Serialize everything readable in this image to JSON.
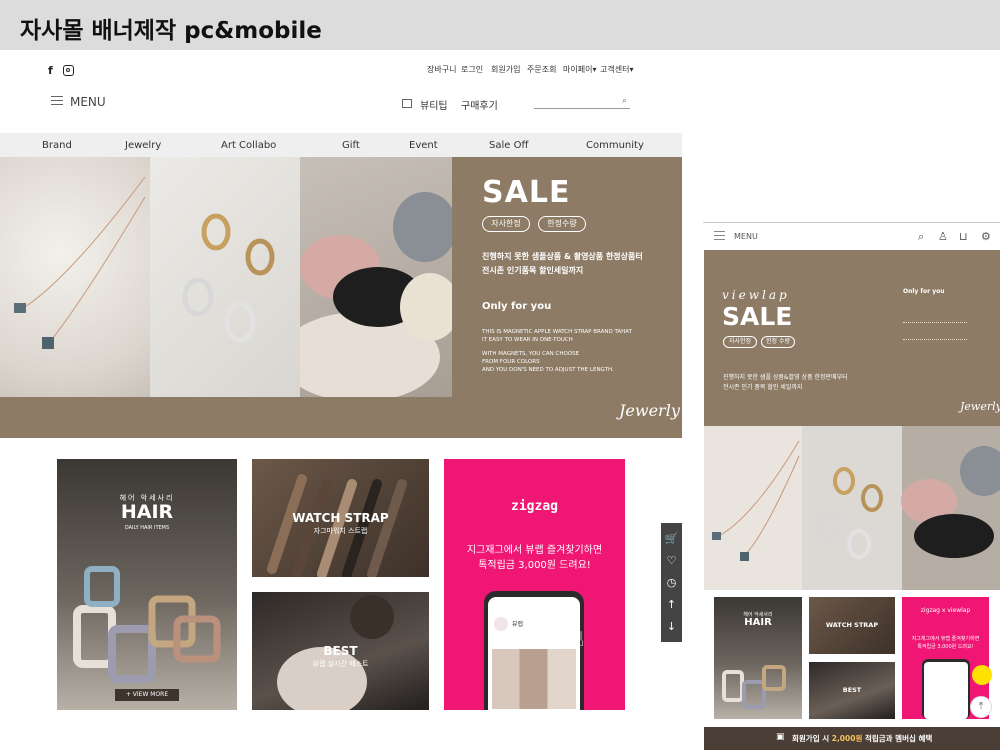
{
  "page": {
    "title": "자사몰 배너제작 pc&mobile"
  },
  "pc": {
    "social": {
      "facebook_icon": "f",
      "instagram_icon": "instagram-icon"
    },
    "util_links": [
      "장바구니",
      "로그인",
      "회원가입",
      "주문조회",
      "마이페이▾",
      "고객센터▾"
    ],
    "menu_label": "MENU",
    "tips_label": "뷰티팁",
    "reviews_label": "구매후기",
    "search_placeholder": "",
    "categories": [
      "Brand",
      "Jewelry",
      "Art Collabo",
      "Gift",
      "Event",
      "Sale Off",
      "Community"
    ],
    "banner": {
      "sale": "SALE",
      "pill1": "자사한정",
      "pill2": "한정수량",
      "desc1": "진행하지 못한 샘플상품 & 촬영상품 한정상품터",
      "desc2": "전시존 인기품목 할인세일까지",
      "only_for_you": "Only for you",
      "eng1": "THIS IS MAGNETIC APPLE WATCH STRAP BRAND TAHAT",
      "eng2": "IT EASY TO WEAR IN ONE-TOUCH",
      "eng3": "WITH MAGNETS, YOU CAN CHOOSE",
      "eng4": "FROM FOUR COLORS",
      "eng5": "AND YOU DON'S NEED TO ADJUST THE LENGTH.",
      "signature": "Jewerly"
    },
    "tiles": {
      "hair": {
        "kicker": "헤어 악세사리",
        "title": "HAIR",
        "sub1": "DAILY HAIR ITEMS",
        "sub2": "",
        "button": "+ VIEW MORE"
      },
      "watch": {
        "title": "WATCH STRAP",
        "sub": "자그마워치 스트랩"
      },
      "best": {
        "title": "BEST",
        "sub": "뷰랩 실시간 베스트"
      },
      "zigzag": {
        "logo": "zigzag",
        "line1": "지그재그에서 뷰랩 즐겨찾기하면",
        "line2": "톡적립금 3,000원 드려요!",
        "app_title": "뷰랩"
      }
    }
  },
  "rail": {
    "icons": [
      "cart-icon",
      "heart-icon",
      "clock-icon",
      "arrow-up-icon",
      "arrow-down-icon"
    ]
  },
  "mobile": {
    "menu_label": "MENU",
    "banner": {
      "script": "viewlap",
      "sale": "SALE",
      "pill1": "자사한정",
      "pill2": "한정 수량",
      "desc1": "진행하지 못한 샘플 상품&촬영 상품 한정판매부터",
      "desc2": "전시존 인기 품목 할인 세일까지",
      "only_for_you": "Only for you",
      "signature": "Jewerly"
    },
    "tiles": {
      "hair": {
        "kicker": "헤어 악세사리",
        "title": "HAIR"
      },
      "watch": {
        "title": "WATCH STRAP"
      },
      "best": {
        "title": "BEST"
      },
      "zigzag": {
        "logo": "zigzag x viewlap",
        "line1": "지그재그에서 뷰랩 즐겨찾기하면",
        "line2": "톡적립금 3,000원 드려요!"
      }
    },
    "footer": {
      "text_before": "회원가입 시 ",
      "highlight": "2,000원",
      "text_after": " 적립금과 멤버십 혜택"
    }
  }
}
